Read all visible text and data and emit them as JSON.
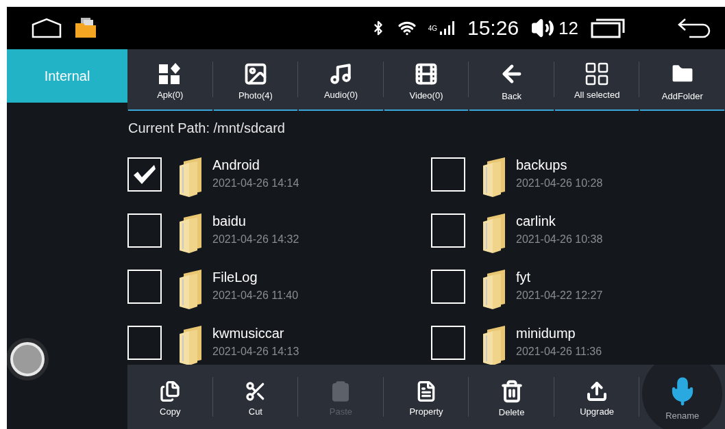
{
  "status_bar": {
    "network": "4G",
    "time": "15:26",
    "volume": "12"
  },
  "sidebar": {
    "items": [
      {
        "label": "Internal",
        "selected": true
      }
    ]
  },
  "toolbar": [
    {
      "label": "Apk(0)"
    },
    {
      "label": "Photo(4)"
    },
    {
      "label": "Audio(0)"
    },
    {
      "label": "Video(0)"
    },
    {
      "label": "Back"
    },
    {
      "label": "All selected"
    },
    {
      "label": "AddFolder"
    }
  ],
  "current_path": "Current Path: /mnt/sdcard",
  "files": [
    {
      "name": "Android",
      "date": "2021-04-26 14:14",
      "checked": true
    },
    {
      "name": "backups",
      "date": "2021-04-26 10:28",
      "checked": false
    },
    {
      "name": "baidu",
      "date": "2021-04-26 14:32",
      "checked": false
    },
    {
      "name": "carlink",
      "date": "2021-04-26 10:38",
      "checked": false
    },
    {
      "name": "FileLog",
      "date": "2021-04-26 11:40",
      "checked": false
    },
    {
      "name": "fyt",
      "date": "2021-04-22 12:27",
      "checked": false
    },
    {
      "name": "kwmusiccar",
      "date": "2021-04-26 14:13",
      "checked": false
    },
    {
      "name": "minidump",
      "date": "2021-04-26 11:36",
      "checked": false
    }
  ],
  "actions": [
    {
      "label": "Copy",
      "disabled": false
    },
    {
      "label": "Cut",
      "disabled": false
    },
    {
      "label": "Paste",
      "disabled": true
    },
    {
      "label": "Property",
      "disabled": false
    },
    {
      "label": "Delete",
      "disabled": false
    },
    {
      "label": "Upgrade",
      "disabled": false
    },
    {
      "label": "Rename",
      "disabled": false
    }
  ]
}
